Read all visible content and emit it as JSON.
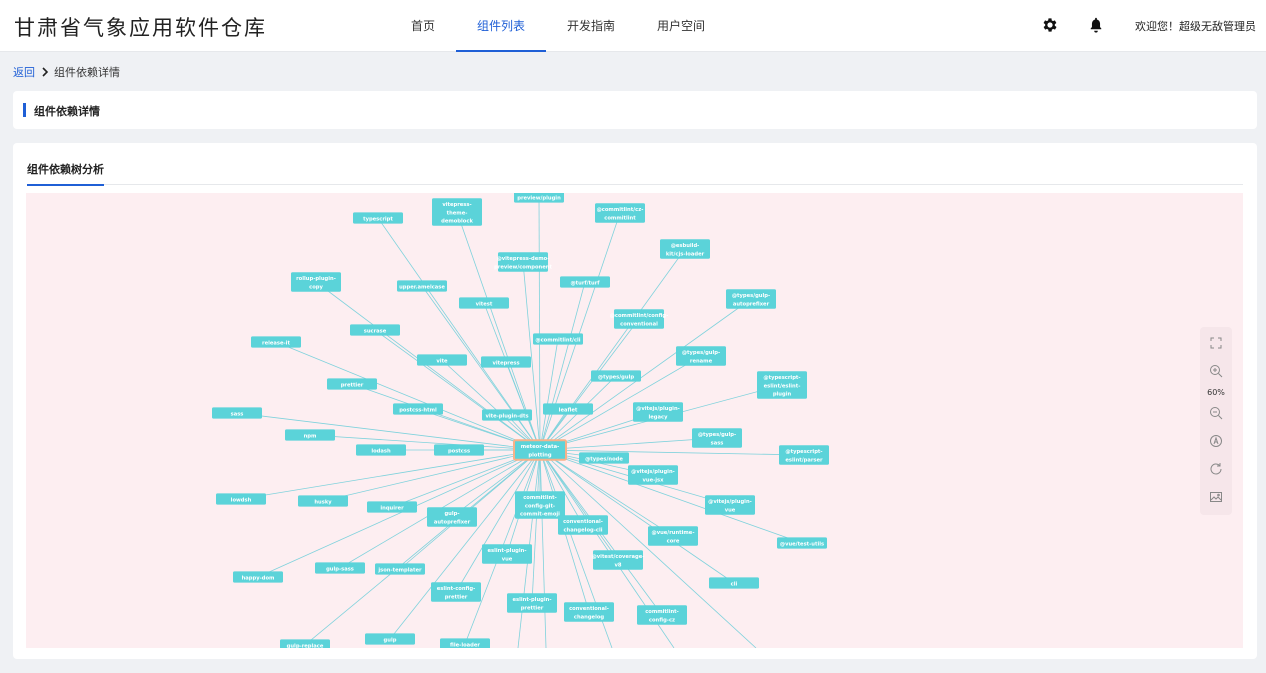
{
  "header": {
    "brand": "甘肃省气象应用软件仓库",
    "nav": [
      "首页",
      "组件列表",
      "开发指南",
      "用户空间"
    ],
    "active_nav": 1,
    "welcome": "欢迎您！超级无敌管理员",
    "icons": [
      "gear-icon",
      "bell-icon"
    ]
  },
  "breadcrumb": {
    "back": "返回",
    "current": "组件依赖详情"
  },
  "title_card": {
    "title": "组件依赖详情"
  },
  "main": {
    "tab": "组件依赖树分析"
  },
  "toolbox": {
    "zoom": "60%",
    "icons": [
      "fullscreen-icon",
      "zoom-in-icon",
      "zoom-out-icon",
      "fit-view-icon",
      "refresh-icon",
      "download-image-icon"
    ]
  },
  "colors": {
    "accent": "#1f5fd6",
    "node_fill": "#5bd3d9",
    "root_border": "#f5b28a",
    "edge": "#7fd2dc",
    "graph_bg": "#fdeef1"
  },
  "graph": {
    "root": "meteor-data-plotting",
    "nodes": [
      {
        "id": "meteor-data-plotting",
        "lines": [
          "meteor-data-",
          "plotting"
        ]
      },
      {
        "id": "typescript",
        "lines": [
          "typescript"
        ]
      },
      {
        "id": "vitepress-theme-demoblock",
        "lines": [
          "vitepress-",
          "theme-",
          "demoblock"
        ]
      },
      {
        "id": "preview-plugin",
        "lines": [
          "preview/plugin"
        ]
      },
      {
        "id": "commitlint-cz-commitlint",
        "lines": [
          "@commitlint/cz-",
          "commitlint"
        ]
      },
      {
        "id": "esbuild-kit-cjs-loader",
        "lines": [
          "@esbuild-",
          "kit/cjs-loader"
        ]
      },
      {
        "id": "vitepress-demo-preview-component",
        "lines": [
          "@vitepress-demo-",
          "preview/component"
        ]
      },
      {
        "id": "rollup-plugin-copy",
        "lines": [
          "rollup-plugin-",
          "copy"
        ]
      },
      {
        "id": "upper-camelcase",
        "lines": [
          "upper.amelcase"
        ]
      },
      {
        "id": "turf-turf",
        "lines": [
          "@turf/turf"
        ]
      },
      {
        "id": "types-gulp-autoprefixer",
        "lines": [
          "@types/gulp-",
          "autoprefixer"
        ]
      },
      {
        "id": "vitest",
        "lines": [
          "vitest"
        ]
      },
      {
        "id": "commitlint-config-conventional",
        "lines": [
          "@commitlint/config-",
          "conventional"
        ]
      },
      {
        "id": "sucrase",
        "lines": [
          "sucrase"
        ]
      },
      {
        "id": "release-it",
        "lines": [
          "release-it"
        ]
      },
      {
        "id": "commitlint-cli",
        "lines": [
          "@commitlint/cli"
        ]
      },
      {
        "id": "vite",
        "lines": [
          "vite"
        ]
      },
      {
        "id": "vitepress",
        "lines": [
          "vitepress"
        ]
      },
      {
        "id": "types-gulp-rename",
        "lines": [
          "@types/gulp-",
          "rename"
        ]
      },
      {
        "id": "prettier",
        "lines": [
          "prettier"
        ]
      },
      {
        "id": "types-gulp",
        "lines": [
          "@types/gulp"
        ]
      },
      {
        "id": "typescript-eslint-eslint-plugin",
        "lines": [
          "@typescript-",
          "eslint/eslint-",
          "plugin"
        ]
      },
      {
        "id": "sass",
        "lines": [
          "sass"
        ]
      },
      {
        "id": "postcss-html",
        "lines": [
          "postcss-html"
        ]
      },
      {
        "id": "vite-plugin-dts",
        "lines": [
          "vite-plugin-dts"
        ]
      },
      {
        "id": "leaflet",
        "lines": [
          "leaflet"
        ]
      },
      {
        "id": "vitejs-plugin-legacy",
        "lines": [
          "@vitejs/plugin-",
          "legacy"
        ]
      },
      {
        "id": "npm",
        "lines": [
          "npm"
        ]
      },
      {
        "id": "types-gulp-sass",
        "lines": [
          "@types/gulp-",
          "sass"
        ]
      },
      {
        "id": "lodash",
        "lines": [
          "lodash"
        ]
      },
      {
        "id": "postcss",
        "lines": [
          "postcss"
        ]
      },
      {
        "id": "typescript-eslint-parser",
        "lines": [
          "@typescript-",
          "eslint/parser"
        ]
      },
      {
        "id": "types-node",
        "lines": [
          "@types/node"
        ]
      },
      {
        "id": "vitejs-plugin-vue-jsx",
        "lines": [
          "@vitejs/plugin-",
          "vue-jsx"
        ]
      },
      {
        "id": "lowdsh",
        "lines": [
          "lowdsh"
        ]
      },
      {
        "id": "husky",
        "lines": [
          "husky"
        ]
      },
      {
        "id": "commitlint-config-git-commit-emoji",
        "lines": [
          "commitlint-",
          "config-git-",
          "commit-emoji"
        ]
      },
      {
        "id": "vitejs-plugin-vue",
        "lines": [
          "@vitejs/plugin-",
          "vue"
        ]
      },
      {
        "id": "inquirer",
        "lines": [
          "inquirer"
        ]
      },
      {
        "id": "gulp-autoprefixer",
        "lines": [
          "gulp-",
          "autoprefixer"
        ]
      },
      {
        "id": "conventional-changelog-cli",
        "lines": [
          "conventional-",
          "changelog-cli"
        ]
      },
      {
        "id": "vue-runtime-core",
        "lines": [
          "@vue/runtime-",
          "core"
        ]
      },
      {
        "id": "vue-test-utils",
        "lines": [
          "@vue/test-utils"
        ]
      },
      {
        "id": "eslint-plugin-vue",
        "lines": [
          "eslint-plugin-",
          "vue"
        ]
      },
      {
        "id": "vitest-coverage-v8",
        "lines": [
          "@vitest/coverage-",
          "v8"
        ]
      },
      {
        "id": "gulp-sass",
        "lines": [
          "gulp-sass"
        ]
      },
      {
        "id": "json-templater",
        "lines": [
          "json-templater"
        ]
      },
      {
        "id": "happy-dom",
        "lines": [
          "happy-dom"
        ]
      },
      {
        "id": "cli",
        "lines": [
          "cli"
        ]
      },
      {
        "id": "eslint-config-prettier",
        "lines": [
          "eslint-config-",
          "prettier"
        ]
      },
      {
        "id": "eslint-plugin-prettier",
        "lines": [
          "eslint-plugin-",
          "prettier"
        ]
      },
      {
        "id": "conventional-changelog",
        "lines": [
          "conventional-",
          "changelog"
        ]
      },
      {
        "id": "commitlint-config-cz",
        "lines": [
          "commitlint-",
          "config-cz"
        ]
      },
      {
        "id": "gulp",
        "lines": [
          "gulp"
        ]
      },
      {
        "id": "gulp-replace",
        "lines": [
          "gulp-replace"
        ]
      },
      {
        "id": "file-loader",
        "lines": [
          "file-loader"
        ]
      }
    ]
  }
}
